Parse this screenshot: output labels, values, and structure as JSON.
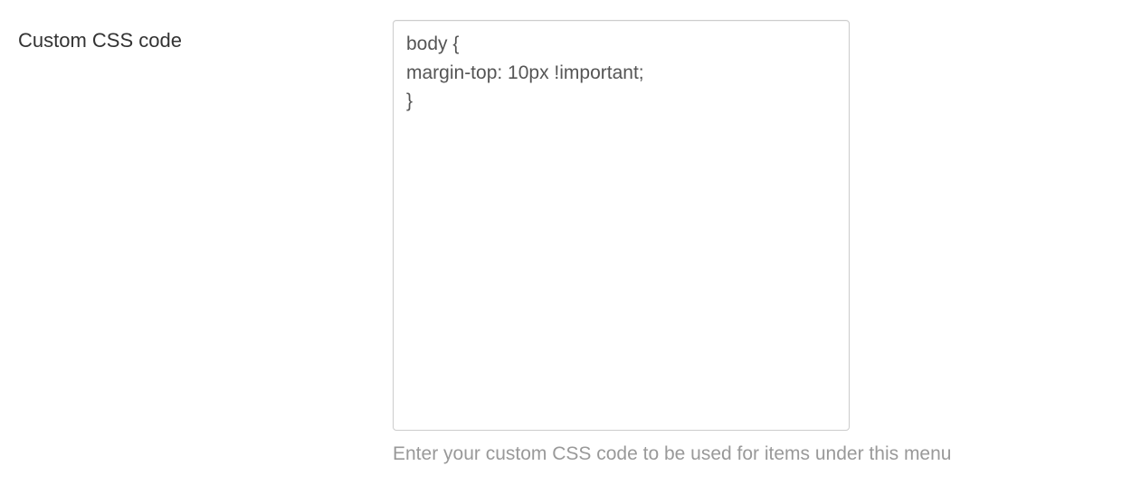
{
  "form": {
    "custom_css": {
      "label": "Custom CSS code",
      "value": "body {\nmargin-top: 10px !important;\n}",
      "help_text": "Enter your custom CSS code to be used for items under this menu"
    }
  }
}
